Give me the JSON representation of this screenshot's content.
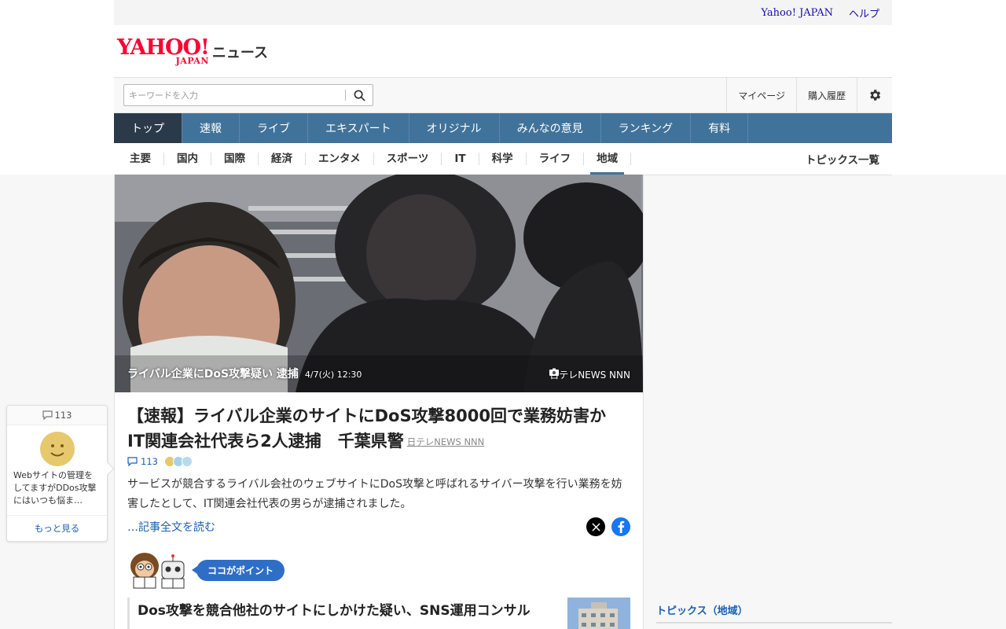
{
  "util": {
    "yahoo_japan": "Yahoo! JAPAN",
    "help": "ヘルプ"
  },
  "logo": {
    "main": "YAHOO!",
    "sub": "JAPAN",
    "suffix": "ニュース"
  },
  "search": {
    "placeholder": "キーワードを入力"
  },
  "search_right": {
    "mypage": "マイページ",
    "history": "購入履歴"
  },
  "gnav": [
    "トップ",
    "速報",
    "ライブ",
    "エキスパート",
    "オリジナル",
    "みんなの意見",
    "ランキング",
    "有料"
  ],
  "cnav": [
    "主要",
    "国内",
    "国際",
    "経済",
    "エンタメ",
    "スポーツ",
    "IT",
    "科学",
    "ライフ",
    "地域"
  ],
  "cnav_right": "トピックス一覧",
  "photo": {
    "caption": "ライバル企業にDoS攻撃疑い 逮捕",
    "date": "4/7(火) 12:30",
    "credit": "日テレNEWS NNN"
  },
  "article": {
    "headline": "【速報】ライバル企業のサイトにDoS攻撃8000回で業務妨害か　IT関連会社代表ら2人逮捕　千葉県警",
    "source": "日テレNEWS NNN",
    "comments": "113",
    "summary": "サービスが競合するライバル会社のウェブサイトにDoS攻撃と呼ばれるサイバー攻撃を行い業務を妨害したとして、IT関連会社代表の男らが逮捕されました。",
    "readmore": "…記事全文を読む"
  },
  "point": {
    "badge": "ココがポイント",
    "title": "Dos攻撃を競合他社のサイトにしかけた疑い、SNS運用コンサル"
  },
  "side": {
    "topics_title": "トピックス（地域）"
  },
  "float_card": {
    "count": "113",
    "text": "Webサイトの管理をしてますがDDos攻撃にはいつも悩ま…",
    "more": "もっと見る"
  },
  "colors": {
    "nav_bg": "#41739a",
    "nav_active": "#2b3a49",
    "logo_red": "#ff0033",
    "link_blue": "#1a5fb4"
  }
}
